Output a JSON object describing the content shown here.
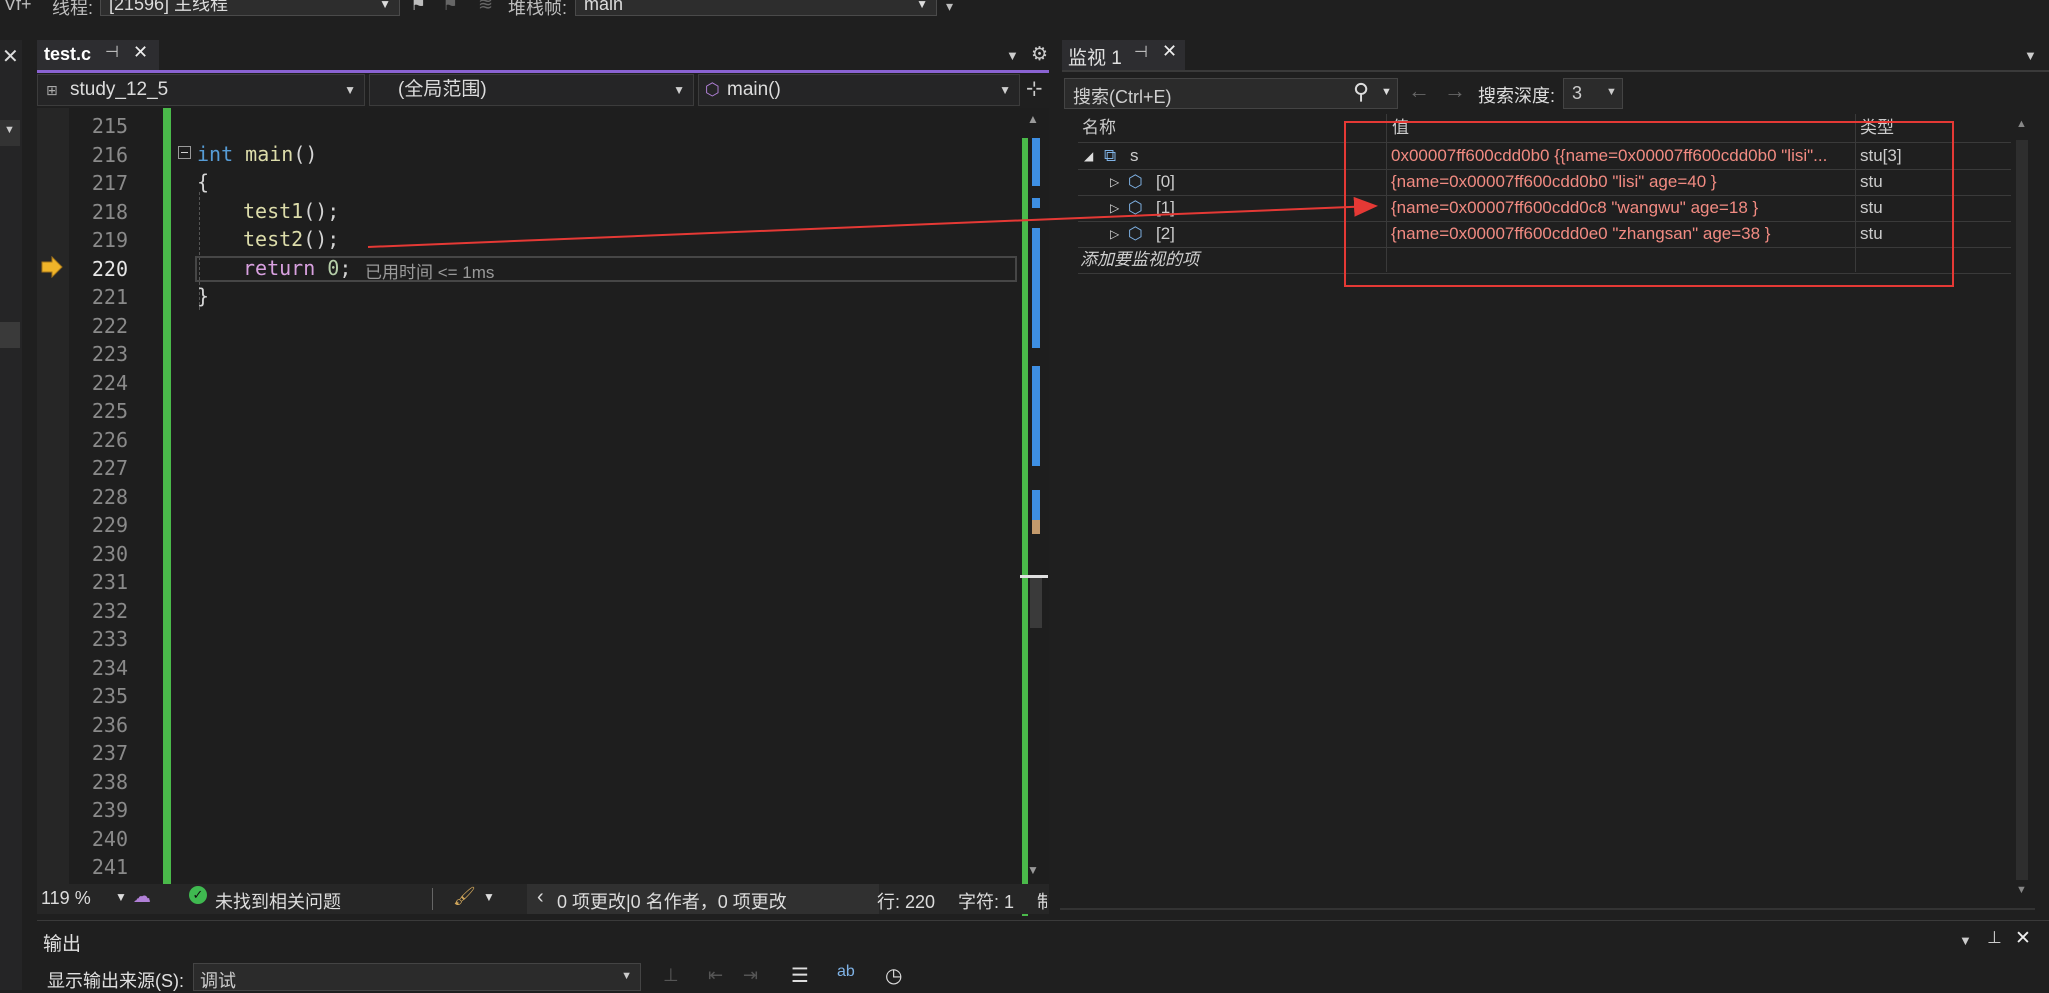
{
  "toolbar": {
    "partial_label": "Vf+",
    "thread_label": "线程:",
    "thread_value": "[21596] 主线程",
    "stackframe_label": "堆栈帧:",
    "stackframe_value": "main"
  },
  "editor_tab": {
    "filename": "test.c"
  },
  "nav": {
    "project": "study_12_5",
    "scope": "(全局范围)",
    "function": "main()"
  },
  "code": {
    "line_numbers": [
      "215",
      "216",
      "217",
      "218",
      "219",
      "220",
      "221",
      "222",
      "223",
      "224",
      "225",
      "226",
      "227",
      "228",
      "229",
      "230",
      "231",
      "232",
      "233",
      "234",
      "235",
      "236",
      "237",
      "238",
      "239",
      "240",
      "241"
    ],
    "l216_kw": "int",
    "l216_fn": "main",
    "l216_paren": "()",
    "l217": "{",
    "l218_fn": "test1",
    "l218_rest": "();",
    "l219_fn": "test2",
    "l219_rest": "();",
    "l220_kw": "return",
    "l220_num": "0",
    "l220_semi": ";",
    "l220_hint": "已用时间 <= 1ms",
    "l221": "}"
  },
  "status": {
    "zoom": "119 %",
    "issues": "未找到相关问题",
    "changes": "0 项更改|0 名作者，0 项更改",
    "line": "行: 220",
    "col": "字符: 1",
    "trailing": "制"
  },
  "watch": {
    "title": "监视 1",
    "search_placeholder": "搜索(Ctrl+E)",
    "depth_label": "搜索深度:",
    "depth_value": "3",
    "col_name": "名称",
    "col_value": "值",
    "col_type": "类型",
    "rows": [
      {
        "name": "s",
        "value": "0x00007ff600cdd0b0 {{name=0x00007ff600cdd0b0 \"lisi\"...",
        "type": "stu[3]"
      },
      {
        "name": "[0]",
        "value": "{name=0x00007ff600cdd0b0 \"lisi\" age=40 }",
        "type": "stu"
      },
      {
        "name": "[1]",
        "value": "{name=0x00007ff600cdd0c8 \"wangwu\" age=18 }",
        "type": "stu"
      },
      {
        "name": "[2]",
        "value": "{name=0x00007ff600cdd0e0 \"zhangsan\" age=38 }",
        "type": "stu"
      }
    ],
    "add_item": "添加要监视的项"
  },
  "output": {
    "title": "输出",
    "source_label": "显示输出来源(S):",
    "source_value": "调试"
  },
  "colors": {
    "accent_tab": "#8a63d2",
    "green_change_bar": "#4ab94a",
    "annotation_red": "#e53935",
    "value_text": "#f28b82"
  }
}
